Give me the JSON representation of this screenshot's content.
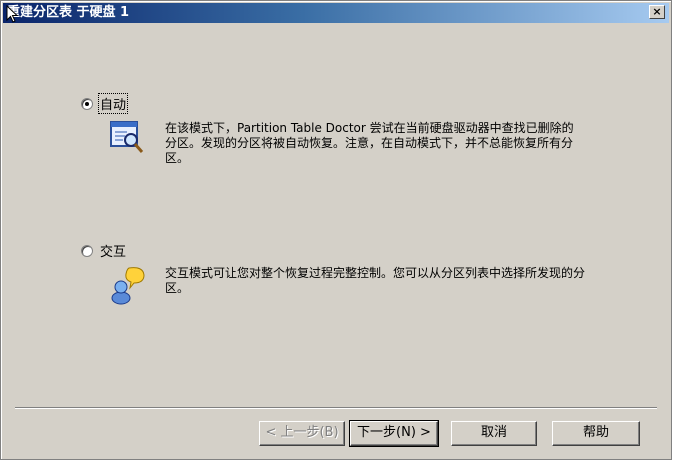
{
  "window": {
    "title": "重建分区表 于硬盘 1",
    "close_label": "×"
  },
  "options": {
    "auto": {
      "label": "自动",
      "selected": true,
      "description": "在该模式下，Partition Table Doctor 尝试在当前硬盘驱动器中查找已删除的分区。发现的分区将被自动恢复。注意，在自动模式下，并不总能恢复所有分区。",
      "icon": "search-scan-icon"
    },
    "interactive": {
      "label": "交互",
      "selected": false,
      "description": "交互模式可让您对整个恢复过程完整控制。您可以从分区列表中选择所发现的分区。",
      "icon": "user-question-icon"
    }
  },
  "buttons": {
    "back": "< 上一步(B)",
    "next": "下一步(N) >",
    "cancel": "取消",
    "help": "帮助"
  }
}
